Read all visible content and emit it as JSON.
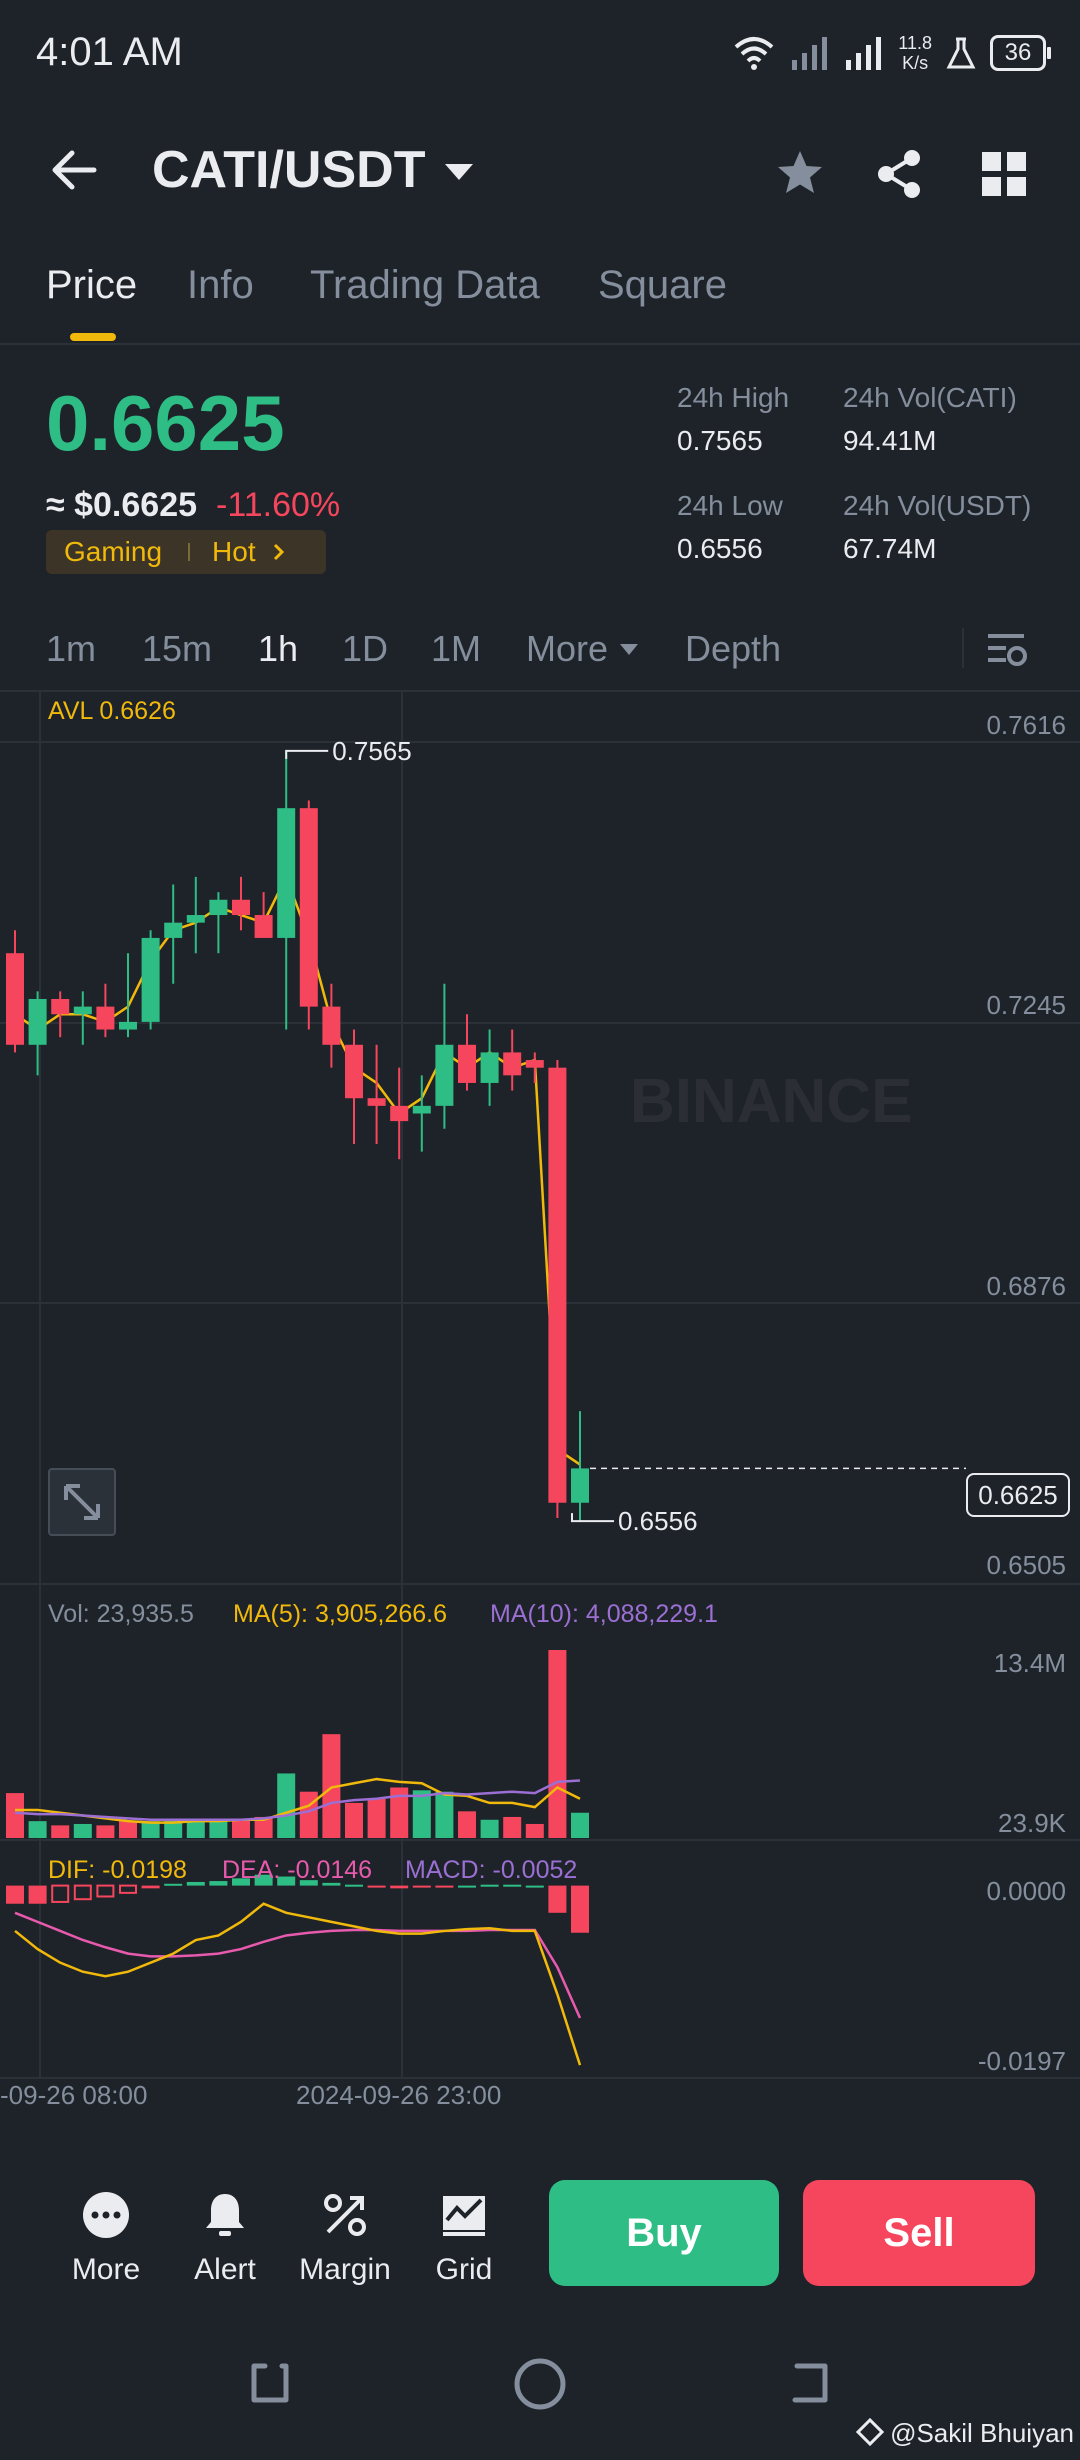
{
  "status": {
    "time": "4:01 AM",
    "net_speed_value": "11.8",
    "net_speed_unit": "K/s",
    "battery": "36"
  },
  "header": {
    "pair": "CATI/USDT"
  },
  "tabs": [
    "Price",
    "Info",
    "Trading Data",
    "Square"
  ],
  "price": {
    "last": "0.6625",
    "usd": "≈ $0.6625",
    "change": "-11.60%",
    "tag_sector": "Gaming",
    "tag_hot": "Hot"
  },
  "stats": {
    "high_label": "24h High",
    "high_value": "0.7565",
    "low_label": "24h Low",
    "low_value": "0.6556",
    "vol_base_label": "24h Vol(CATI)",
    "vol_base_value": "94.41M",
    "vol_quote_label": "24h Vol(USDT)",
    "vol_quote_value": "67.74M"
  },
  "intervals": {
    "i1": "1m",
    "i2": "15m",
    "i3": "1h",
    "i4": "1D",
    "i5": "1M",
    "more": "More",
    "depth": "Depth"
  },
  "chart": {
    "avl": "AVL 0.6626",
    "axis": [
      "0.7616",
      "0.7245",
      "0.6876",
      "0.6505"
    ],
    "high_marker": "0.7565",
    "low_marker": "0.6556",
    "last_price_tag": "0.6625",
    "watermark": "BINANCE"
  },
  "volume": {
    "vol": "Vol: 23,935.5",
    "ma5": "MA(5): 3,905,266.6",
    "ma10": "MA(10): 4,088,229.1",
    "axis_top": "13.4M",
    "axis_bottom": "23.9K"
  },
  "macd": {
    "dif": "DIF: -0.0198",
    "dea": "DEA: -0.0146",
    "macd": "MACD: -0.0052",
    "axis_top": "0.0000",
    "axis_bottom": "-0.0197"
  },
  "time_axis": [
    "-09-26 08:00",
    "2024-09-26 23:00"
  ],
  "bottom": {
    "more": "More",
    "alert": "Alert",
    "margin": "Margin",
    "grid": "Grid",
    "buy": "Buy",
    "sell": "Sell"
  },
  "credit": "@Sakil Bhuiyan",
  "colors": {
    "up": "#2EBD85",
    "down": "#F6465D",
    "accent": "#F0B90B",
    "bg": "#1E2329"
  },
  "chart_data": {
    "type": "candlestick",
    "interval": "1h",
    "ylim": [
      0.6505,
      0.7616
    ],
    "candles": [
      {
        "o": 0.73,
        "h": 0.733,
        "l": 0.717,
        "c": 0.718
      },
      {
        "o": 0.718,
        "h": 0.725,
        "l": 0.714,
        "c": 0.724
      },
      {
        "o": 0.724,
        "h": 0.725,
        "l": 0.719,
        "c": 0.722
      },
      {
        "o": 0.722,
        "h": 0.725,
        "l": 0.718,
        "c": 0.723
      },
      {
        "o": 0.723,
        "h": 0.726,
        "l": 0.719,
        "c": 0.72
      },
      {
        "o": 0.72,
        "h": 0.73,
        "l": 0.719,
        "c": 0.721
      },
      {
        "o": 0.721,
        "h": 0.733,
        "l": 0.72,
        "c": 0.732
      },
      {
        "o": 0.732,
        "h": 0.739,
        "l": 0.726,
        "c": 0.734
      },
      {
        "o": 0.734,
        "h": 0.74,
        "l": 0.73,
        "c": 0.735
      },
      {
        "o": 0.735,
        "h": 0.738,
        "l": 0.73,
        "c": 0.737
      },
      {
        "o": 0.737,
        "h": 0.74,
        "l": 0.733,
        "c": 0.735
      },
      {
        "o": 0.735,
        "h": 0.738,
        "l": 0.732,
        "c": 0.732
      },
      {
        "o": 0.732,
        "h": 0.7565,
        "l": 0.72,
        "c": 0.749
      },
      {
        "o": 0.749,
        "h": 0.75,
        "l": 0.72,
        "c": 0.723
      },
      {
        "o": 0.723,
        "h": 0.726,
        "l": 0.715,
        "c": 0.718
      },
      {
        "o": 0.718,
        "h": 0.72,
        "l": 0.705,
        "c": 0.711
      },
      {
        "o": 0.711,
        "h": 0.718,
        "l": 0.705,
        "c": 0.71
      },
      {
        "o": 0.71,
        "h": 0.715,
        "l": 0.703,
        "c": 0.708
      },
      {
        "o": 0.709,
        "h": 0.714,
        "l": 0.704,
        "c": 0.71
      },
      {
        "o": 0.71,
        "h": 0.726,
        "l": 0.707,
        "c": 0.718
      },
      {
        "o": 0.718,
        "h": 0.722,
        "l": 0.712,
        "c": 0.713
      },
      {
        "o": 0.713,
        "h": 0.72,
        "l": 0.71,
        "c": 0.717
      },
      {
        "o": 0.717,
        "h": 0.72,
        "l": 0.712,
        "c": 0.714
      },
      {
        "o": 0.716,
        "h": 0.717,
        "l": 0.713,
        "c": 0.715
      },
      {
        "o": 0.715,
        "h": 0.716,
        "l": 0.656,
        "c": 0.658
      },
      {
        "o": 0.658,
        "h": 0.67,
        "l": 0.6556,
        "c": 0.6625
      }
    ],
    "avg_line": [
      0.722,
      0.72,
      0.722,
      0.722,
      0.721,
      0.723,
      0.729,
      0.733,
      0.734,
      0.736,
      0.735,
      0.734,
      0.74,
      0.732,
      0.721,
      0.715,
      0.713,
      0.709,
      0.711,
      0.717,
      0.715,
      0.717,
      0.715,
      0.716,
      0.665,
      0.663
    ],
    "volume": [
      3.2,
      1.2,
      0.9,
      1.0,
      0.9,
      1.2,
      1.2,
      1.3,
      1.2,
      1.3,
      1.3,
      1.5,
      4.6,
      3.3,
      7.4,
      2.5,
      2.8,
      3.6,
      3.4,
      3.3,
      1.9,
      1.3,
      1.5,
      1.0,
      13.4,
      1.8
    ],
    "volume_up": [
      false,
      true,
      false,
      true,
      false,
      false,
      true,
      true,
      true,
      true,
      false,
      false,
      true,
      false,
      false,
      false,
      false,
      false,
      true,
      true,
      false,
      true,
      false,
      false,
      false,
      true
    ],
    "ma5": [
      2.0,
      2.0,
      1.8,
      1.6,
      1.4,
      1.2,
      1.1,
      1.1,
      1.2,
      1.2,
      1.3,
      1.3,
      1.8,
      2.3,
      3.6,
      3.9,
      4.2,
      4.0,
      3.9,
      3.1,
      3.0,
      2.5,
      2.5,
      2.2,
      3.6,
      2.8
    ],
    "ma10": [
      1.8,
      1.7,
      1.7,
      1.6,
      1.5,
      1.4,
      1.3,
      1.3,
      1.3,
      1.3,
      1.3,
      1.4,
      1.6,
      1.9,
      2.5,
      2.7,
      2.8,
      3.0,
      3.0,
      3.2,
      3.1,
      3.2,
      3.3,
      3.2,
      4.0,
      4.1
    ],
    "macd_hist": [
      -0.002,
      -0.002,
      -0.0018,
      -0.0015,
      -0.0012,
      -0.0008,
      -0.0003,
      0.0002,
      0.0004,
      0.0005,
      0.0008,
      0.0012,
      0.001,
      0.0006,
      0.0003,
      0.0001,
      -0.0002,
      -0.0003,
      -0.0002,
      -0.0002,
      0.0,
      0.0001,
      0.0001,
      0.0,
      -0.003,
      -0.0052
    ],
    "dif": [
      -0.005,
      -0.007,
      -0.0085,
      -0.0095,
      -0.01,
      -0.0095,
      -0.0085,
      -0.0075,
      -0.006,
      -0.0055,
      -0.004,
      -0.002,
      -0.003,
      -0.0035,
      -0.004,
      -0.0045,
      -0.005,
      -0.0053,
      -0.0053,
      -0.005,
      -0.0048,
      -0.0047,
      -0.005,
      -0.005,
      -0.012,
      -0.0198
    ],
    "dea": [
      -0.003,
      -0.004,
      -0.005,
      -0.006,
      -0.0068,
      -0.0075,
      -0.0078,
      -0.0078,
      -0.0077,
      -0.0075,
      -0.007,
      -0.0062,
      -0.0055,
      -0.0052,
      -0.005,
      -0.0049,
      -0.0049,
      -0.005,
      -0.005,
      -0.005,
      -0.005,
      -0.0049,
      -0.0049,
      -0.0049,
      -0.009,
      -0.0146
    ],
    "macd_ylim": [
      -0.021,
      0.0015
    ]
  }
}
